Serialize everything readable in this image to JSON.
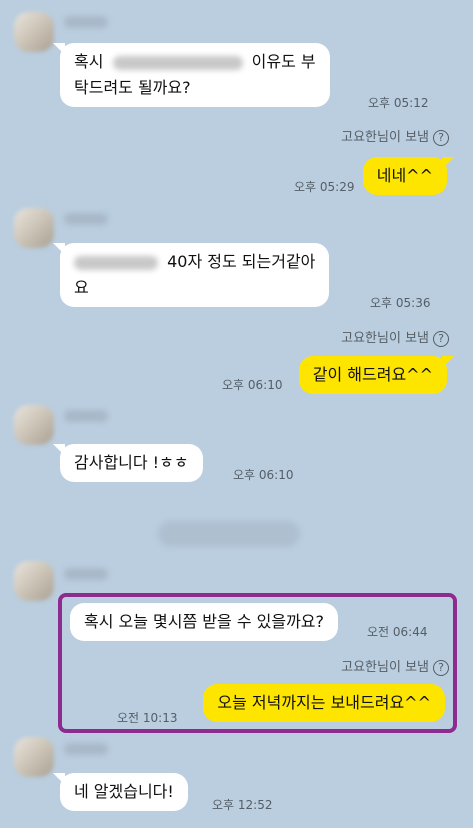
{
  "messages": [
    {
      "parts": [
        "혹시",
        "이유도 부",
        "탁드려도 될까요?"
      ],
      "time": "오후 05:12"
    },
    {
      "note": "고요한님이 보냄",
      "help": "?",
      "text": "네네^^",
      "time": "오후 05:29"
    },
    {
      "parts": [
        "40자 정도 되는거같아",
        "요"
      ],
      "time": "오후 05:36"
    },
    {
      "note": "고요한님이 보냄",
      "help": "?",
      "text": "같이 해드려요^^",
      "time": "오후 06:10"
    },
    {
      "text": "감사합니다 !ㅎㅎ",
      "time": "오후 06:10"
    },
    {
      "text": "혹시 오늘 몇시쯤 받을 수 있을까요?",
      "time": "오전 06:44"
    },
    {
      "note": "고요한님이 보냄",
      "help": "?",
      "text": "오늘 저녁까지는 보내드려요^^",
      "time": "오전 10:13"
    },
    {
      "text": "네 알겠습니다!",
      "time": "오후 12:52"
    }
  ],
  "colors": {
    "background": "#bacee0",
    "incoming_bubble": "#ffffff",
    "outgoing_bubble": "#fee500",
    "highlight_border": "#8e2b8f"
  }
}
